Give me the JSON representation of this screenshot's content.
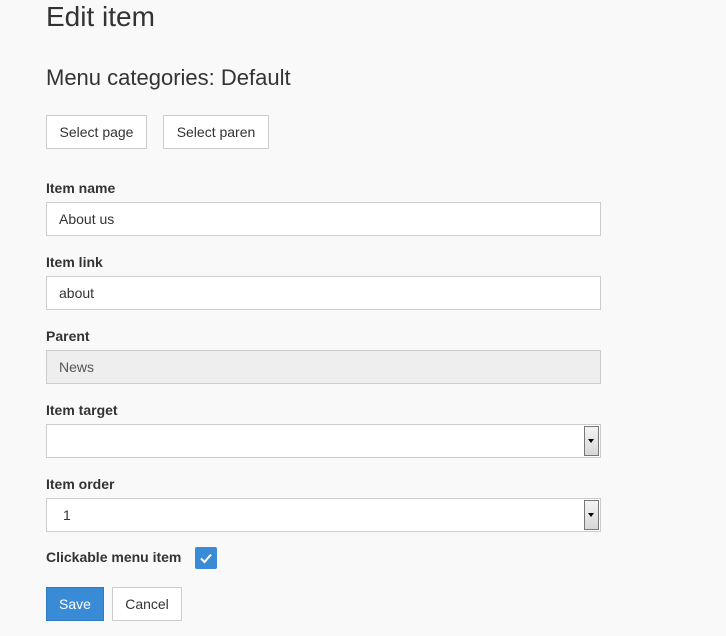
{
  "page": {
    "title": "Edit item",
    "subtitle": "Menu categories: Default"
  },
  "toolbar": {
    "select_page_label": "Select page",
    "select_parent_label": "Select paren"
  },
  "form": {
    "item_name": {
      "label": "Item name",
      "value": "About us"
    },
    "item_link": {
      "label": "Item link",
      "value": "about"
    },
    "parent": {
      "label": "Parent",
      "value": "News"
    },
    "item_target": {
      "label": "Item target",
      "value": ""
    },
    "item_order": {
      "label": "Item order",
      "value": "1"
    },
    "clickable": {
      "label": "Clickable menu item",
      "checked": true
    }
  },
  "actions": {
    "save_label": "Save",
    "cancel_label": "Cancel"
  },
  "colors": {
    "primary": "#3a8bd6",
    "background": "#f9f9f9",
    "disabled_field": "#eeeeee"
  },
  "icons": {
    "checkbox": "checkmark-icon",
    "select_arrow": "chevron-down-icon"
  }
}
